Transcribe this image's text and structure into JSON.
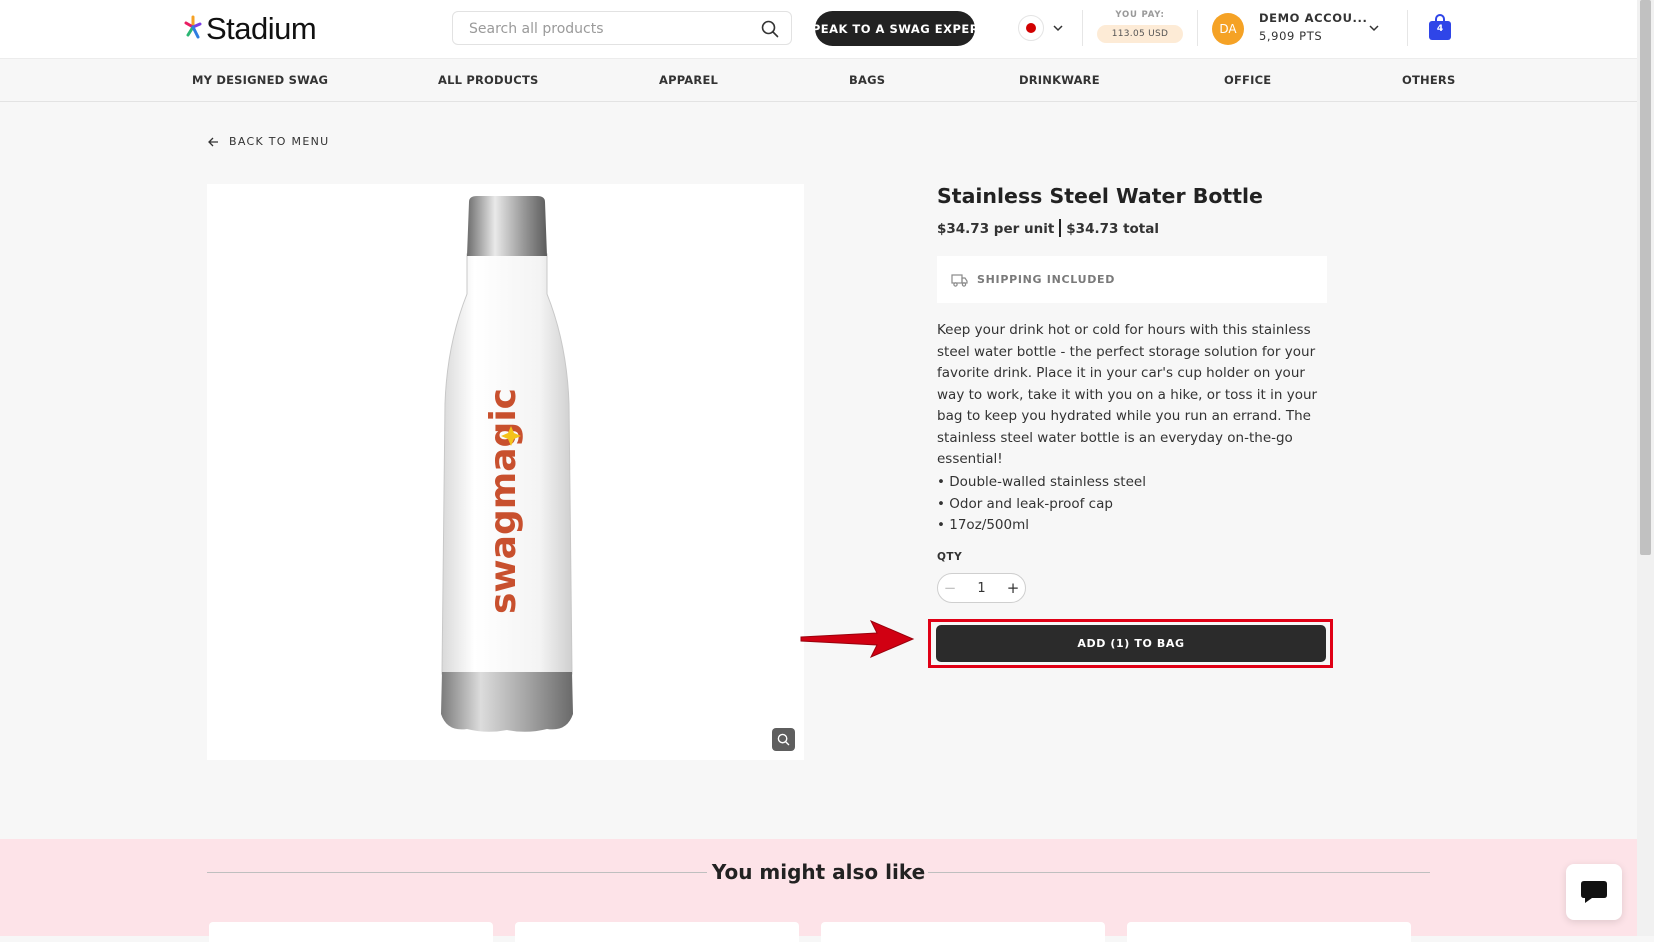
{
  "header": {
    "logo_text": "Stadium",
    "search_placeholder": "Search all products",
    "expert_button": "SPEAK TO A SWAG EXPERT",
    "you_pay_label": "YOU PAY:",
    "you_pay_amount": "113.05 USD",
    "avatar_initials": "DA",
    "account_name": "DEMO ACCOU...",
    "account_points": "5,909 PTS",
    "cart_count": "4"
  },
  "nav": {
    "items": [
      "MY DESIGNED SWAG",
      "ALL PRODUCTS",
      "APPAREL",
      "BAGS",
      "DRINKWARE",
      "OFFICE",
      "OTHERS"
    ]
  },
  "back_link": "BACK TO MENU",
  "product": {
    "title": "Stainless Steel Water Bottle",
    "unit_price": "$34.73 per unit",
    "total_price": "$34.73 total",
    "shipping_label": "SHIPPING INCLUDED",
    "description": "Keep your drink hot or cold for hours with this stainless steel water bottle - the perfect storage solution for your favorite drink. Place it in your car's cup holder on your way to work, take it with you on a hike, or toss it in your bag to keep you hydrated while you run an errand. The stainless steel water bottle is an everyday on-the-go essential!",
    "bullets": [
      "• Double-walled stainless steel",
      "• Odor and leak-proof cap",
      "• 17oz/500ml"
    ],
    "qty_label": "QTY",
    "qty_value": "1",
    "add_button": "ADD (1) TO BAG",
    "image_brand_text": "swagmagic"
  },
  "recommendations": {
    "title": "You might also like"
  },
  "colors": {
    "highlight": "#e00016",
    "button_dark": "#2b2b2b",
    "avatar": "#f5a225",
    "cart": "#2f45e8",
    "reco_background": "#fde3e8"
  },
  "icons": {
    "search": "search-icon",
    "chevron": "chevron-down-icon",
    "back": "arrow-left-icon",
    "shipping": "truck-icon",
    "zoom": "zoom-icon",
    "cart": "shopping-bag-icon",
    "chat": "chat-icon"
  }
}
